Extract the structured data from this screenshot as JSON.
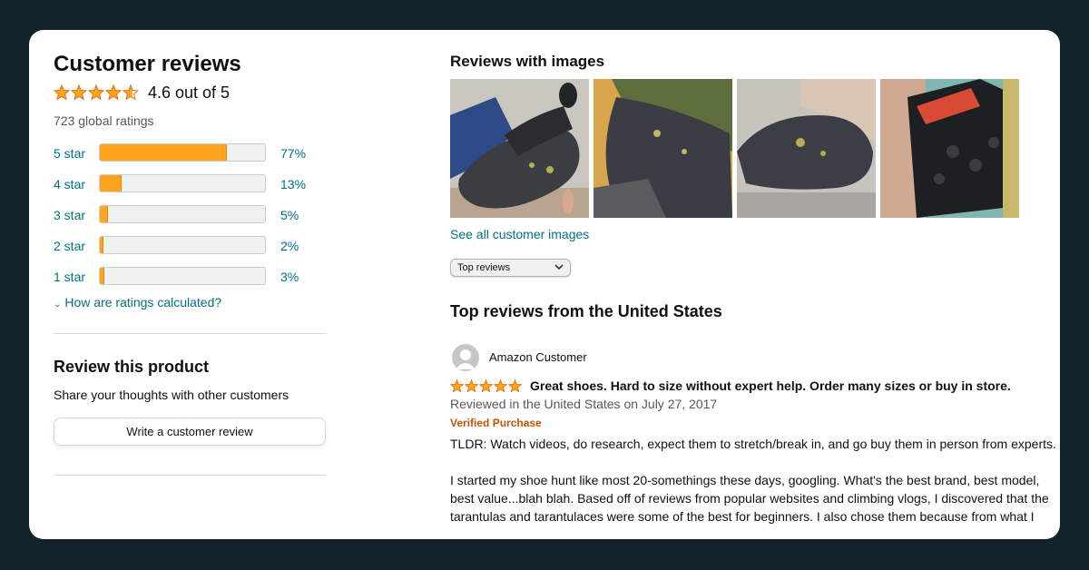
{
  "summary": {
    "title": "Customer reviews",
    "rating": 4.6,
    "rating_text": "4.6 out of 5",
    "global_ratings": "723 global ratings",
    "histogram": [
      {
        "label": "5 star",
        "percent_text": "77%",
        "value": 77
      },
      {
        "label": "4 star",
        "percent_text": "13%",
        "value": 13
      },
      {
        "label": "3 star",
        "percent_text": "5%",
        "value": 5
      },
      {
        "label": "2 star",
        "percent_text": "2%",
        "value": 2
      },
      {
        "label": "1 star",
        "percent_text": "3%",
        "value": 3
      }
    ],
    "how_link": "How are ratings calculated?"
  },
  "review_product": {
    "title": "Review this product",
    "subtitle": "Share your thoughts with other customers",
    "button": "Write a customer review"
  },
  "images_section": {
    "title": "Reviews with images",
    "see_all": "See all customer images",
    "sort_selected": "Top reviews"
  },
  "reviews_section": {
    "title": "Top reviews from the United States",
    "review": {
      "author": "Amazon Customer",
      "stars": 5,
      "headline": "Great shoes. Hard to size without expert help. Order many sizes or buy in store.",
      "date": "Reviewed in the United States on July 27, 2017",
      "verified": "Verified Purchase",
      "paragraph_1": "TLDR: Watch videos, do research, expect them to stretch/break in, and go buy them in person from experts.",
      "paragraph_2": "I started my shoe hunt like most 20-somethings these days, googling. What's the best brand, best model, best value...blah blah. Based off of reviews from popular websites and climbing vlogs, I discovered that the tarantulas and tarantulaces were some of the best for beginners. I also chose them because from what I"
    }
  },
  "colors": {
    "star": "#ffa41c",
    "link": "#007185",
    "verified": "#c45500",
    "frame": "#12222b"
  }
}
